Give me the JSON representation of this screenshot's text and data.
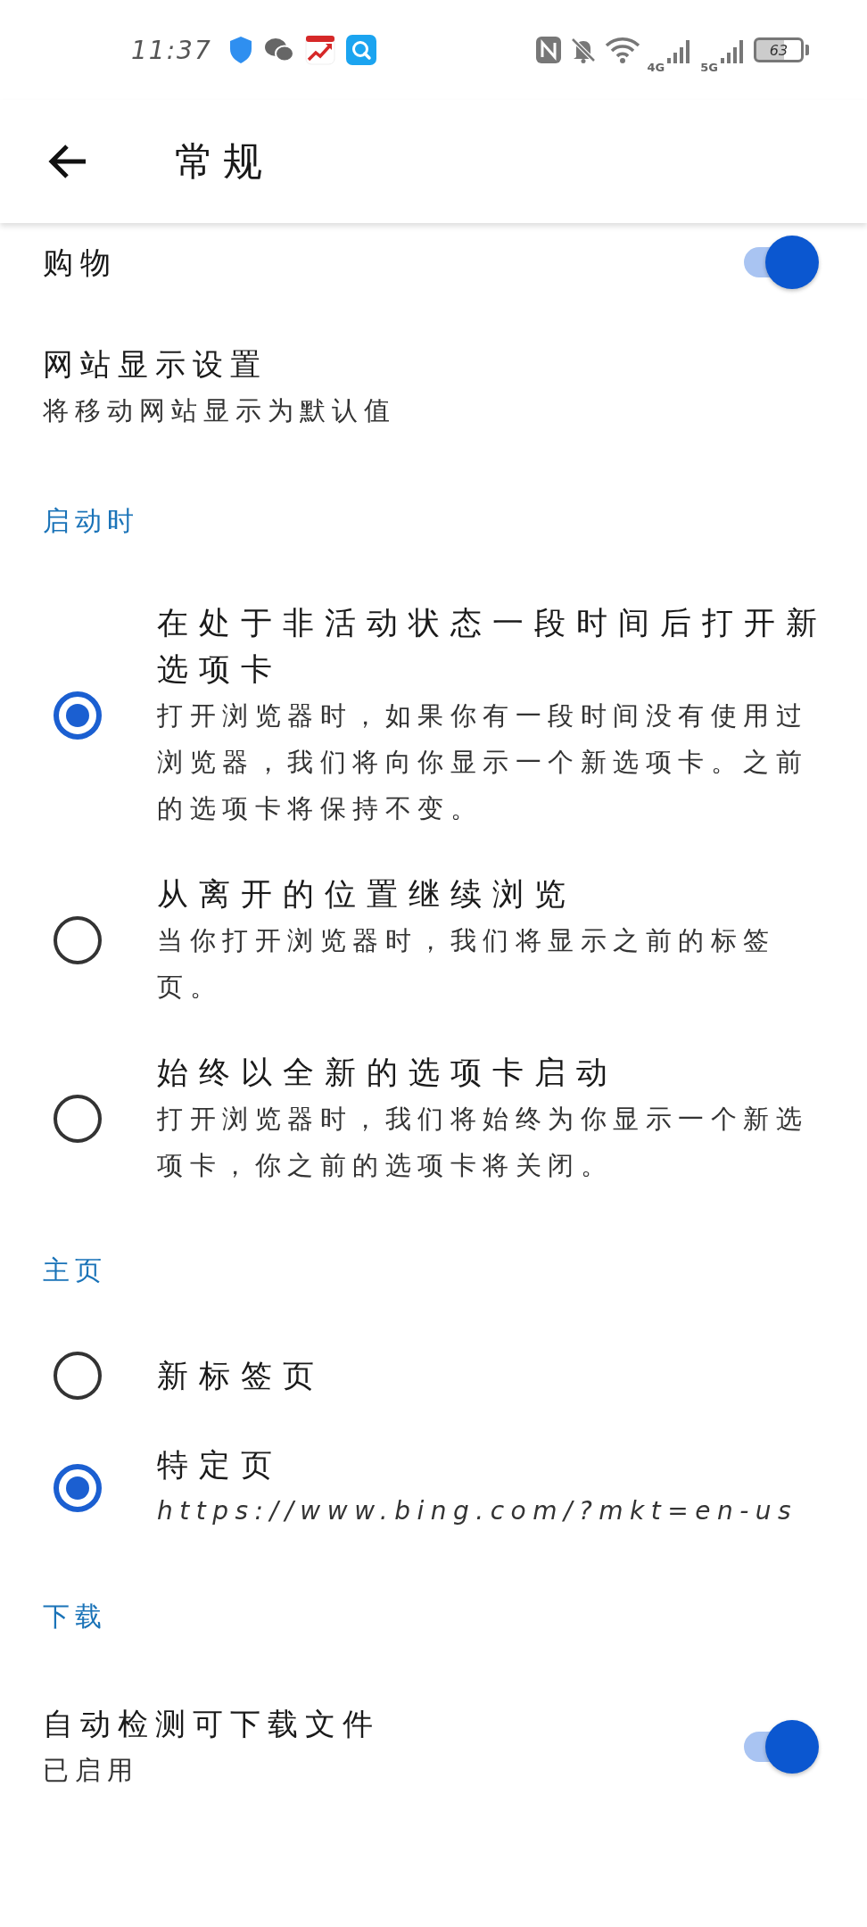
{
  "status_bar": {
    "time": "11:37",
    "network_1": "4G",
    "network_2": "5G",
    "battery": "63"
  },
  "app_bar": {
    "title": "常规"
  },
  "sections": [
    {
      "items": [
        {
          "kind": "toggle",
          "title": "购物",
          "on": true
        },
        {
          "kind": "link",
          "title": "网站显示设置",
          "subtitle": "将移动网站显示为默认值"
        }
      ]
    },
    {
      "header": "启动时",
      "items": [
        {
          "kind": "radio",
          "title": "在处于非活动状态一段时间后打开新选项卡",
          "subtitle": "打开浏览器时，如果你有一段时间没有使用过浏览器，我们将向你显示一个新选项卡。之前的选项卡将保持不变。",
          "selected": true
        },
        {
          "kind": "radio",
          "title": "从离开的位置继续浏览",
          "subtitle": "当你打开浏览器时，我们将显示之前的标签页。",
          "selected": false
        },
        {
          "kind": "radio",
          "title": "始终以全新的选项卡启动",
          "subtitle": "打开浏览器时，我们将始终为你显示一个新选项卡，你之前的选项卡将关闭。",
          "selected": false
        }
      ]
    },
    {
      "header": "主页",
      "items": [
        {
          "kind": "radio",
          "title": "新标签页",
          "selected": false
        },
        {
          "kind": "radio",
          "title": "特定页",
          "subtitle": "https://www.bing.com/?mkt=en-us",
          "selected": true
        }
      ]
    },
    {
      "header": "下载",
      "items": [
        {
          "kind": "toggle",
          "title": "自动检测可下载文件",
          "subtitle": "已启用",
          "on": true
        }
      ]
    }
  ]
}
